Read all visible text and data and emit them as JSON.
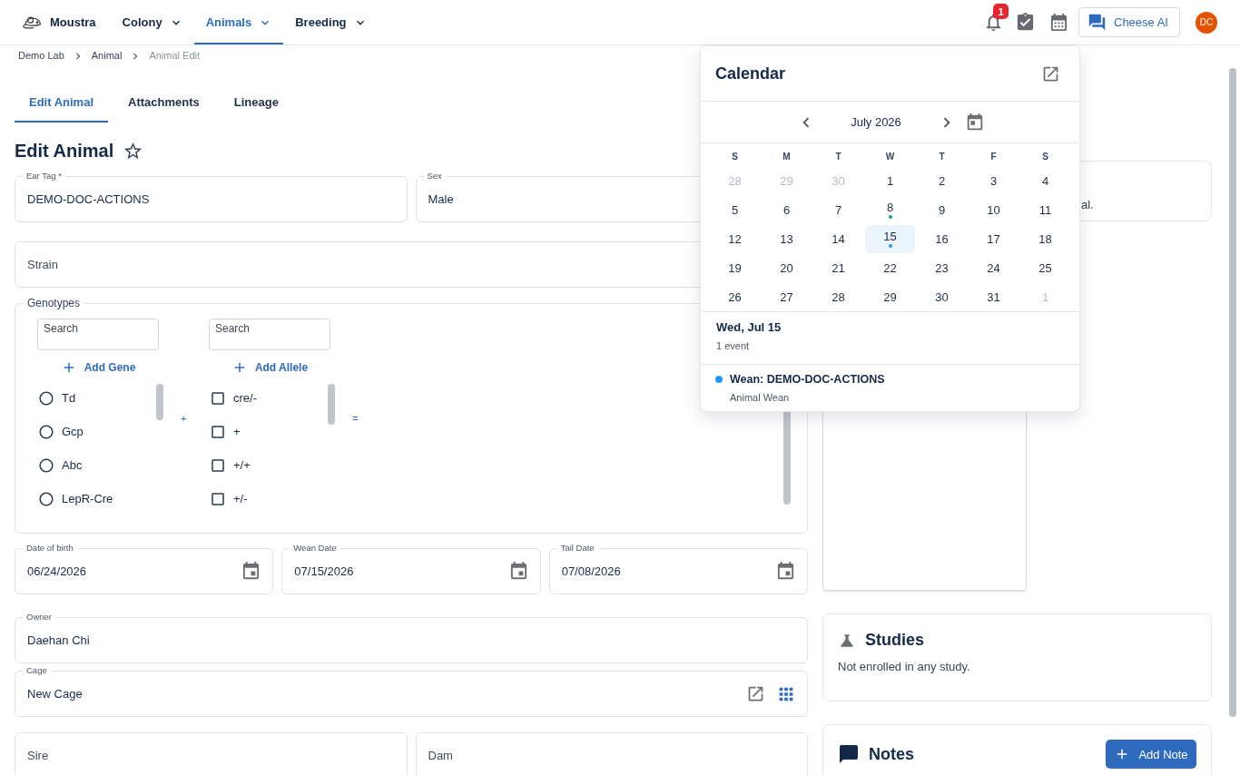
{
  "navbar": {
    "brand": "Moustra",
    "menu": [
      {
        "label": "Colony",
        "selected": false
      },
      {
        "label": "Animals",
        "selected": true
      },
      {
        "label": "Breeding",
        "selected": false
      }
    ],
    "notification_count": "1",
    "assistant_button": "Cheese AI",
    "avatar_initials": "DC"
  },
  "breadcrumb": [
    {
      "label": "Demo Lab",
      "current": false
    },
    {
      "label": "Animal",
      "current": false
    },
    {
      "label": "Animal Edit",
      "current": true
    }
  ],
  "tabs": [
    {
      "label": "Edit Animal",
      "selected": true
    },
    {
      "label": "Attachments",
      "selected": false
    },
    {
      "label": "Lineage",
      "selected": false
    }
  ],
  "page_title": "Edit Animal",
  "favorite": false,
  "form": {
    "ear_tag": {
      "label": "Ear Tag *",
      "value": "DEMO-DOC-ACTIONS"
    },
    "sex": {
      "label": "Sex",
      "value": "Male"
    },
    "strain": {
      "placeholder": "Strain"
    },
    "genotypes": {
      "legend": "Genotypes",
      "genes": {
        "search_placeholder": "Search",
        "add_button": "Add Gene",
        "options": [
          {
            "label": "Td",
            "selected": false
          },
          {
            "label": "Gcp",
            "selected": false
          },
          {
            "label": "Abc",
            "selected": false
          },
          {
            "label": "LepR-Cre",
            "selected": false
          }
        ]
      },
      "join_symbol": "+",
      "alleles": {
        "search_placeholder": "Search",
        "add_button": "Add Allele",
        "options": [
          {
            "label": "cre/-",
            "checked": false
          },
          {
            "label": "+",
            "checked": false
          },
          {
            "label": "+/+",
            "checked": false
          },
          {
            "label": "+/-",
            "checked": false
          }
        ]
      },
      "result_symbol": "="
    },
    "date_of_birth": {
      "label": "Date of birth",
      "value": "06/24/2026"
    },
    "wean_date": {
      "label": "Wean Date",
      "value": "07/15/2026"
    },
    "tail_date": {
      "label": "Tail Date",
      "value": "07/08/2026"
    },
    "owner": {
      "label": "Owner",
      "value": "Daehan Chi"
    },
    "cage": {
      "label": "Cage",
      "value": "New Cage"
    },
    "sire": {
      "placeholder": "Sire"
    },
    "dam": {
      "placeholder": "Dam"
    }
  },
  "side": {
    "partial_card_text": "al.",
    "studies": {
      "title": "Studies",
      "empty_text": "Not enrolled in any study."
    },
    "notes": {
      "title": "Notes",
      "add_button": "Add Note"
    }
  },
  "calendar_popover": {
    "title": "Calendar",
    "month": "July 2026",
    "weekdays": [
      "S",
      "M",
      "T",
      "W",
      "T",
      "F",
      "S"
    ],
    "days": [
      {
        "label": "28",
        "outside": true,
        "selected": false
      },
      {
        "label": "29",
        "outside": true,
        "selected": false
      },
      {
        "label": "30",
        "outside": true,
        "selected": false
      },
      {
        "label": "1",
        "outside": false,
        "selected": false
      },
      {
        "label": "2",
        "outside": false,
        "selected": false
      },
      {
        "label": "3",
        "outside": false,
        "selected": false
      },
      {
        "label": "4",
        "outside": false,
        "selected": false
      },
      {
        "label": "5",
        "outside": false,
        "selected": false
      },
      {
        "label": "6",
        "outside": false,
        "selected": false
      },
      {
        "label": "7",
        "outside": false,
        "selected": false
      },
      {
        "label": "8",
        "outside": false,
        "selected": false,
        "color": "#12a08a"
      },
      {
        "label": "9",
        "outside": false,
        "selected": false
      },
      {
        "label": "10",
        "outside": false,
        "selected": false
      },
      {
        "label": "11",
        "outside": false,
        "selected": false
      },
      {
        "label": "12",
        "outside": false,
        "selected": false
      },
      {
        "label": "13",
        "outside": false,
        "selected": false
      },
      {
        "label": "14",
        "outside": false,
        "selected": false
      },
      {
        "label": "15",
        "outside": false,
        "selected": true,
        "color": "#2196f3"
      },
      {
        "label": "16",
        "outside": false,
        "selected": false
      },
      {
        "label": "17",
        "outside": false,
        "selected": false
      },
      {
        "label": "18",
        "outside": false,
        "selected": false
      },
      {
        "label": "19",
        "outside": false,
        "selected": false
      },
      {
        "label": "20",
        "outside": false,
        "selected": false
      },
      {
        "label": "21",
        "outside": false,
        "selected": false
      },
      {
        "label": "22",
        "outside": false,
        "selected": false
      },
      {
        "label": "23",
        "outside": false,
        "selected": false
      },
      {
        "label": "24",
        "outside": false,
        "selected": false
      },
      {
        "label": "25",
        "outside": false,
        "selected": false
      },
      {
        "label": "26",
        "outside": false,
        "selected": false
      },
      {
        "label": "27",
        "outside": false,
        "selected": false
      },
      {
        "label": "28",
        "outside": false,
        "selected": false
      },
      {
        "label": "29",
        "outside": false,
        "selected": false
      },
      {
        "label": "30",
        "outside": false,
        "selected": false
      },
      {
        "label": "31",
        "outside": false,
        "selected": false
      },
      {
        "label": "1",
        "outside": true,
        "selected": false
      }
    ],
    "selected_date": "Wed, Jul 15",
    "event_count": "1 event",
    "events": [
      {
        "title": "Wean: DEMO-DOC-ACTIONS",
        "type": "Animal Wean",
        "color": "#2196f3"
      }
    ]
  }
}
